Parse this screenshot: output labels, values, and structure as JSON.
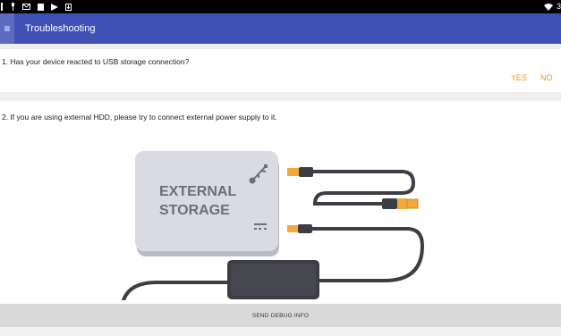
{
  "status_bar": {
    "icons": [
      "notification-icon",
      "usb-icon",
      "mail-icon",
      "file-icon",
      "play-store-icon",
      "download-icon"
    ],
    "right_icons": [
      "wifi-icon"
    ],
    "time": "3"
  },
  "app_bar": {
    "menu_icon": "hamburger-menu-icon",
    "title": "Troubleshooting",
    "color": "#3f51b5"
  },
  "questions": [
    {
      "text": "1. Has your device reacted to USB storage connection?",
      "yes_label": "YES",
      "no_label": "NO"
    },
    {
      "text": "2. If you are using external HDD, please try to connect external power supply to it."
    }
  ],
  "illustration": {
    "drive_label_line1": "EXTERNAL",
    "drive_label_line2": "STORAGE"
  },
  "footer": {
    "debug_button_label": "SEND DEBUG INFO"
  },
  "colors": {
    "accent": "#ff9800",
    "drive": "#d9dae3",
    "cable": "#3d3d45",
    "connector": "#f2a93b"
  }
}
